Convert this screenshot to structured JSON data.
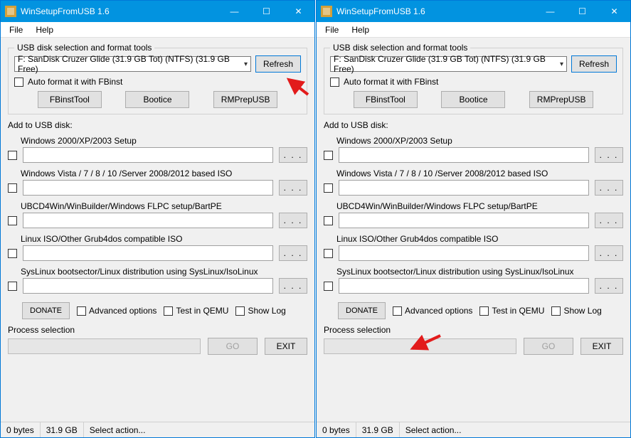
{
  "window": {
    "title": "WinSetupFromUSB 1.6",
    "buttons": {
      "min": "—",
      "max": "☐",
      "close": "✕"
    }
  },
  "menu": {
    "file": "File",
    "help": "Help"
  },
  "disk_group": {
    "legend": "USB disk selection and format tools",
    "selected_drive": "F: SanDisk Cruzer Glide (31.9 GB Tot) (NTFS) (31.9 GB Free)",
    "refresh": "Refresh",
    "autoformat": "Auto format it with FBinst",
    "tools": {
      "fbinst": "FBinstTool",
      "bootice": "Bootice",
      "rmprep": "RMPrepUSB"
    }
  },
  "add": {
    "header": "Add to USB disk:",
    "items": [
      {
        "label": "Windows 2000/XP/2003 Setup"
      },
      {
        "label": "Windows Vista / 7 / 8 / 10 /Server 2008/2012 based ISO"
      },
      {
        "label": "UBCD4Win/WinBuilder/Windows FLPC setup/BartPE"
      },
      {
        "label": "Linux ISO/Other Grub4dos compatible ISO"
      },
      {
        "label": "SysLinux bootsector/Linux distribution using SysLinux/IsoLinux"
      }
    ],
    "browse": ". . ."
  },
  "lower": {
    "donate": "DONATE",
    "advanced": "Advanced options",
    "qemu": "Test in QEMU",
    "showlog": "Show Log"
  },
  "process": {
    "label": "Process selection",
    "go": "GO",
    "exit": "EXIT"
  },
  "status": {
    "bytes": "0 bytes",
    "size": "31.9 GB",
    "action": "Select action..."
  }
}
